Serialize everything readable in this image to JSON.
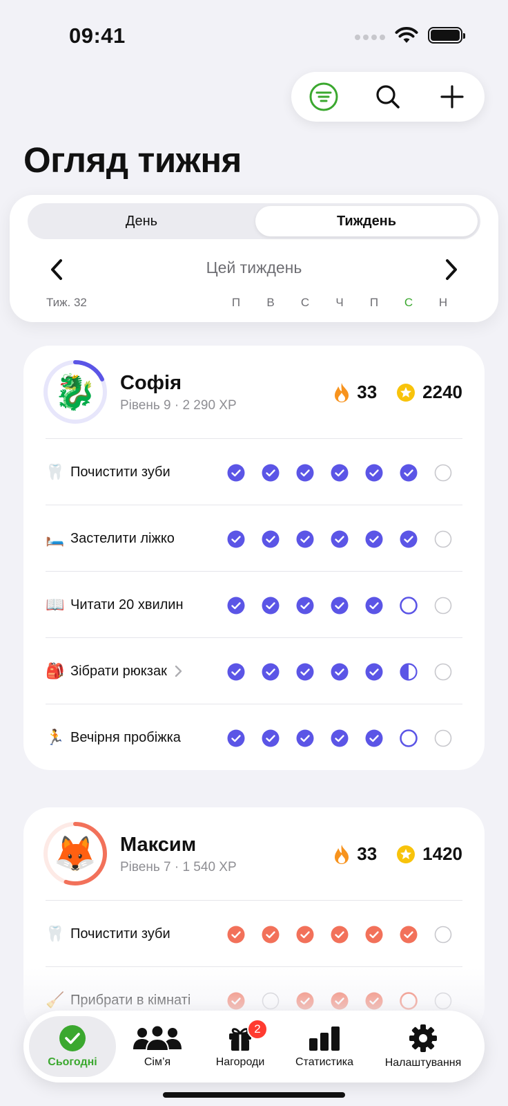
{
  "status_bar": {
    "time": "09:41"
  },
  "toolbar": {
    "filter_icon": "filter-circle-icon",
    "search_icon": "search-icon",
    "add_icon": "plus-icon"
  },
  "page_title": "Огляд тижня",
  "period": {
    "segments": [
      {
        "label": "День"
      },
      {
        "label": "Тиждень",
        "selected": true
      }
    ],
    "label": "Цей тиждень",
    "week_number": "Тиж. 32",
    "days": [
      "П",
      "В",
      "С",
      "Ч",
      "П",
      "С",
      "Н"
    ],
    "today_index": 5,
    "accent_color": "#3BA82F"
  },
  "members": [
    {
      "name": "Софія",
      "subtitle": "Рівень 9 · 2 290 XP",
      "avatar_emoji": "🐉",
      "ring_color": "#5B55E6",
      "ring_progress": 0.18,
      "streak": "33",
      "points": "2240",
      "check_color": "#5B55E6",
      "tasks": [
        {
          "emoji": "🦷",
          "label": "Почистити зуби",
          "has_chevron": false,
          "days": [
            "done",
            "done",
            "done",
            "done",
            "done",
            "done",
            "empty"
          ]
        },
        {
          "emoji": "🛏️",
          "label": "Застелити ліжко",
          "has_chevron": false,
          "days": [
            "done",
            "done",
            "done",
            "done",
            "done",
            "done",
            "empty"
          ]
        },
        {
          "emoji": "📖",
          "label": "Читати 20 хвилин",
          "has_chevron": false,
          "days": [
            "done",
            "done",
            "done",
            "done",
            "done",
            "open",
            "empty"
          ]
        },
        {
          "emoji": "🎒",
          "label": "Зібрати рюкзак",
          "has_chevron": true,
          "days": [
            "done",
            "done",
            "done",
            "done",
            "done",
            "half",
            "empty"
          ]
        },
        {
          "emoji": "🏃",
          "label": "Вечірня пробіжка",
          "has_chevron": false,
          "days": [
            "done",
            "done",
            "done",
            "done",
            "done",
            "open",
            "empty"
          ]
        }
      ]
    },
    {
      "name": "Максим",
      "subtitle": "Рівень 7 · 1 540 XP",
      "avatar_emoji": "🦊",
      "ring_color": "#F2715A",
      "ring_progress": 0.55,
      "streak": "33",
      "points": "1420",
      "check_color": "#F2715A",
      "tasks": [
        {
          "emoji": "🦷",
          "label": "Почистити зуби",
          "has_chevron": false,
          "days": [
            "done",
            "done",
            "done",
            "done",
            "done",
            "done",
            "empty"
          ]
        },
        {
          "emoji": "🧹",
          "label": "Прибрати в кімнаті",
          "has_chevron": false,
          "days": [
            "done",
            "empty",
            "done",
            "done",
            "done",
            "open",
            "empty"
          ]
        }
      ]
    }
  ],
  "tab_bar": {
    "tabs": [
      {
        "label": "Сьогодні",
        "icon": "checkmark-circle-icon",
        "active": true
      },
      {
        "label": "Сім’я",
        "icon": "people-icon"
      },
      {
        "label": "Нагороди",
        "icon": "gift-icon",
        "badge": "2"
      },
      {
        "label": "Статистика",
        "icon": "bar-chart-icon"
      },
      {
        "label": "Налаштування",
        "icon": "gear-icon"
      }
    ]
  }
}
